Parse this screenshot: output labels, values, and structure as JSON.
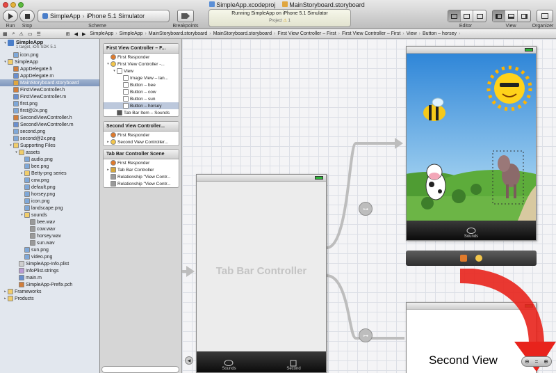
{
  "toolbar": {
    "run_label": "Run",
    "stop_label": "Stop",
    "scheme_app": "SimpleApp",
    "scheme_sep": "›",
    "scheme_dest": "iPhone 5.1 Simulator",
    "scheme_label": "Scheme",
    "breakpoints_label": "Breakpoints",
    "editor_label": "Editor",
    "view_label": "View",
    "organizer_label": "Organizer"
  },
  "window": {
    "project_file": "SimpleApp.xcodeproj",
    "storyboard_file": "MainStoryboard.storyboard"
  },
  "status": {
    "message": "Running SimpleApp on iPhone 5.1 Simulator",
    "project": "Project",
    "warnings": "1"
  },
  "jumpbar": [
    "SimpleApp",
    "SimpleApp",
    "MainStoryboard.storyboard",
    "MainStoryboard.storyboard",
    "First View Controller – First",
    "First View Controller – First",
    "View",
    "Button – horsey"
  ],
  "navigator": {
    "project_name": "SimpleApp",
    "project_sub": "1 target, iOS SDK 5.1",
    "items": [
      {
        "label": "icon.png",
        "depth": 1,
        "icon": "image-icon"
      },
      {
        "label": "SimpleApp",
        "depth": 0,
        "icon": "folder-icon",
        "open": true
      },
      {
        "label": "AppDelegate.h",
        "depth": 1,
        "icon": "header-file-icon"
      },
      {
        "label": "AppDelegate.m",
        "depth": 1,
        "icon": "source-file-icon"
      },
      {
        "label": "MainStoryboard.storyboard",
        "depth": 1,
        "icon": "storyboard-icon",
        "selected": true
      },
      {
        "label": "FirstViewController.h",
        "depth": 1,
        "icon": "header-file-icon"
      },
      {
        "label": "FirstViewController.m",
        "depth": 1,
        "icon": "source-file-icon"
      },
      {
        "label": "first.png",
        "depth": 1,
        "icon": "image-icon"
      },
      {
        "label": "first@2x.png",
        "depth": 1,
        "icon": "image-icon"
      },
      {
        "label": "SecondViewController.h",
        "depth": 1,
        "icon": "header-file-icon"
      },
      {
        "label": "SecondViewController.m",
        "depth": 1,
        "icon": "source-file-icon"
      },
      {
        "label": "second.png",
        "depth": 1,
        "icon": "image-icon"
      },
      {
        "label": "second@2x.png",
        "depth": 1,
        "icon": "image-icon"
      },
      {
        "label": "Supporting Files",
        "depth": 1,
        "icon": "folder-icon",
        "open": true
      },
      {
        "label": "assets",
        "depth": 2,
        "icon": "folder-icon",
        "open": true
      },
      {
        "label": "audio.png",
        "depth": 3,
        "icon": "image-icon"
      },
      {
        "label": "bee.png",
        "depth": 3,
        "icon": "image-icon"
      },
      {
        "label": "Betty-png series",
        "depth": 3,
        "icon": "folder-icon",
        "open": false
      },
      {
        "label": "cow.png",
        "depth": 3,
        "icon": "image-icon"
      },
      {
        "label": "default.png",
        "depth": 3,
        "icon": "image-icon"
      },
      {
        "label": "horsey.png",
        "depth": 3,
        "icon": "image-icon"
      },
      {
        "label": "icon.png",
        "depth": 3,
        "icon": "image-icon"
      },
      {
        "label": "landscape.png",
        "depth": 3,
        "icon": "image-icon"
      },
      {
        "label": "sounds",
        "depth": 3,
        "icon": "folder-icon",
        "open": true
      },
      {
        "label": "bee.wav",
        "depth": 4,
        "icon": "audio-file-icon"
      },
      {
        "label": "cow.wav",
        "depth": 4,
        "icon": "audio-file-icon"
      },
      {
        "label": "horsey.wav",
        "depth": 4,
        "icon": "audio-file-icon"
      },
      {
        "label": "sun.wav",
        "depth": 4,
        "icon": "audio-file-icon"
      },
      {
        "label": "sun.png",
        "depth": 3,
        "icon": "image-icon"
      },
      {
        "label": "video.png",
        "depth": 3,
        "icon": "image-icon"
      },
      {
        "label": "SimpleApp-Info.plist",
        "depth": 2,
        "icon": "plist-icon"
      },
      {
        "label": "InfoPlist.strings",
        "depth": 2,
        "icon": "strings-icon"
      },
      {
        "label": "main.m",
        "depth": 2,
        "icon": "source-file-icon"
      },
      {
        "label": "SimpleApp-Prefix.pch",
        "depth": 2,
        "icon": "header-file-icon"
      },
      {
        "label": "Frameworks",
        "depth": 0,
        "icon": "folder-icon",
        "open": false
      },
      {
        "label": "Products",
        "depth": 0,
        "icon": "folder-icon",
        "open": false
      }
    ]
  },
  "outline": {
    "scene1": {
      "title": "First View Controller – F...",
      "rows": [
        {
          "label": "First Responder",
          "depth": 0,
          "icon": "first-responder-icon"
        },
        {
          "label": "First View Controller -...",
          "depth": 0,
          "icon": "view-controller-icon",
          "tri": "▾"
        },
        {
          "label": "View",
          "depth": 1,
          "icon": "view-icon",
          "tri": "▾"
        },
        {
          "label": "Image View – lan...",
          "depth": 2,
          "icon": "view-icon"
        },
        {
          "label": "Button – bee",
          "depth": 2,
          "icon": "view-icon"
        },
        {
          "label": "Button – cow",
          "depth": 2,
          "icon": "view-icon"
        },
        {
          "label": "Button – sun",
          "depth": 2,
          "icon": "view-icon"
        },
        {
          "label": "Button – horsey",
          "depth": 2,
          "icon": "view-icon",
          "selected": true
        },
        {
          "label": "Tab Bar Item – Sounds",
          "depth": 1,
          "icon": "tab-bar-item-icon"
        }
      ]
    },
    "scene2": {
      "title": "Second View Controller...",
      "rows": [
        {
          "label": "First Responder",
          "depth": 0,
          "icon": "first-responder-icon"
        },
        {
          "label": "Second View Controller...",
          "depth": 0,
          "icon": "view-controller-icon",
          "tri": "▸"
        }
      ]
    },
    "scene3": {
      "title": "Tab Bar Controller Scene",
      "rows": [
        {
          "label": "First Responder",
          "depth": 0,
          "icon": "first-responder-icon"
        },
        {
          "label": "Tab Bar Controller",
          "depth": 0,
          "icon": "tab-bar-controller-icon",
          "tri": "▸"
        },
        {
          "label": "Relationship \"View Contr...",
          "depth": 0,
          "icon": "relationship-icon"
        },
        {
          "label": "Relationship \"View Contr...",
          "depth": 0,
          "icon": "relationship-icon"
        }
      ]
    }
  },
  "canvas": {
    "tab_bar_controller_title": "Tab Bar Controller",
    "tab_sounds": "Sounds",
    "tab_second": "Second",
    "first_tab_label": "Sounds",
    "second_view_label": "Second View"
  },
  "colors": {
    "sky_top": "#2f86d8",
    "sky_bottom": "#bfe4f6",
    "grass": "#5dac3b",
    "annotation_arrow": "#e8231c"
  }
}
